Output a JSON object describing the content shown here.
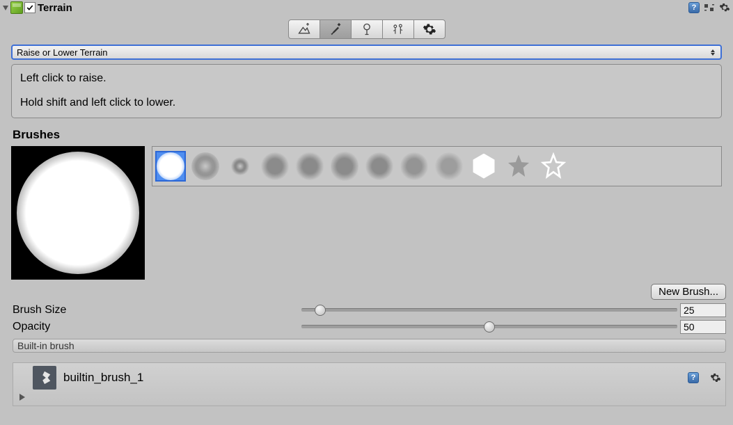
{
  "header": {
    "title": "Terrain",
    "enabled": true
  },
  "toolbar": {
    "buttons": [
      "raise_lower",
      "paint",
      "trees",
      "details",
      "settings"
    ],
    "active": "paint"
  },
  "dropdown": {
    "value": "Raise or Lower Terrain"
  },
  "info": {
    "line1": "Left click to raise.",
    "line2": "Hold shift and left click to lower."
  },
  "sections": {
    "brushes": "Brushes"
  },
  "brush_palette": {
    "items": [
      "soft_round",
      "ring_large",
      "ring_small",
      "scatter_1",
      "scatter_2",
      "scatter_3",
      "scatter_4",
      "scatter_5",
      "scatter_6",
      "hexagon",
      "star_filled",
      "star_outline"
    ],
    "selected_index": 0
  },
  "buttons": {
    "new_brush": "New Brush..."
  },
  "params": {
    "brush_size": {
      "label": "Brush Size",
      "value": "25",
      "min": 1,
      "max": 500,
      "pct": 5
    },
    "opacity": {
      "label": "Opacity",
      "value": "50",
      "min": 0,
      "max": 100,
      "pct": 50
    }
  },
  "subheader": {
    "label": "Built-in brush"
  },
  "asset": {
    "name": "builtin_brush_1"
  }
}
